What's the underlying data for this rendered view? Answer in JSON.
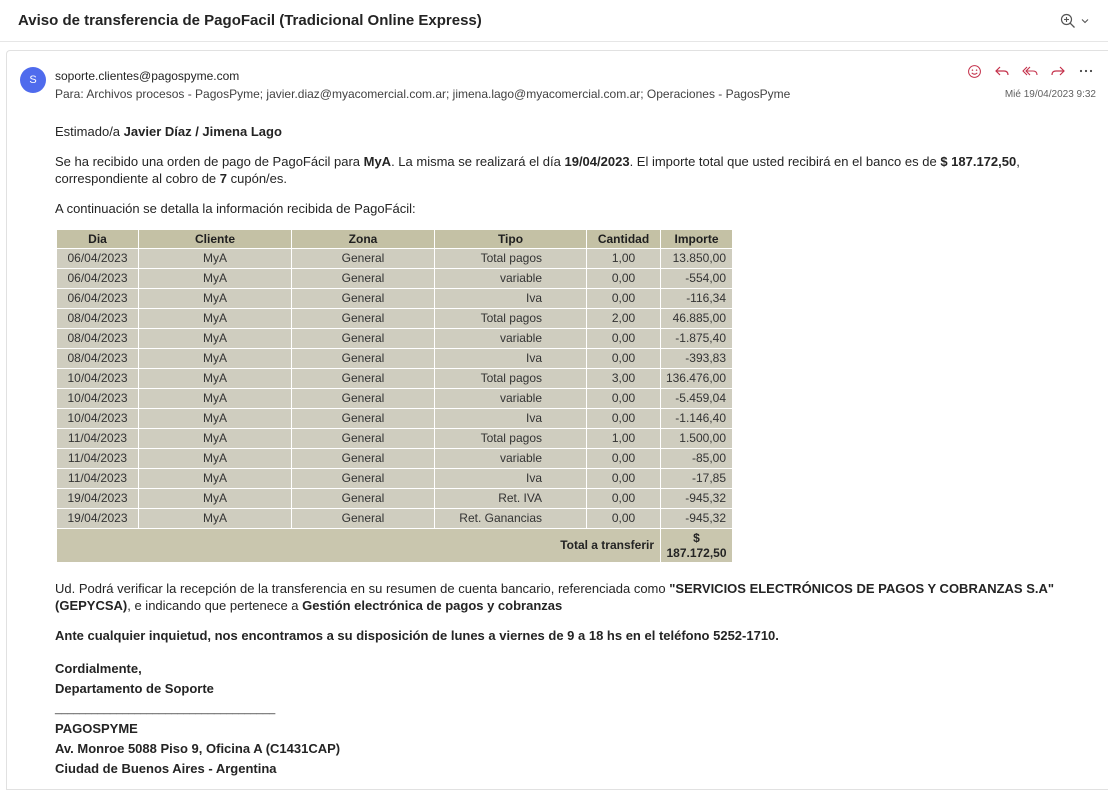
{
  "subject": "Aviso de transferencia de PagoFacil (Tradicional Online Express)",
  "sender": {
    "avatar_initial": "S",
    "from": "soporte.clientes@pagospyme.com",
    "to": "Para:  Archivos procesos - PagosPyme; javier.diaz@myacomercial.com.ar; jimena.lago@myacomercial.com.ar; Operaciones - PagosPyme",
    "date": "Mié 19/04/2023 9:32"
  },
  "actions": [
    "emoji-icon",
    "reply-icon",
    "reply-all-icon",
    "forward-icon",
    "more-icon"
  ],
  "accent": "#c4314b",
  "body": {
    "greeting_prefix": "Estimado/a ",
    "greeting_name": "Javier Díaz / Jimena Lago",
    "order_1": "Se ha recibido una orden de pago de PagoFácil para ",
    "order_company": "MyA",
    "order_2": ". La misma se realizará el día ",
    "order_date": "19/04/2023",
    "order_3": ". El importe total que usted recibirá en el banco es de ",
    "order_amount": "$ 187.172,50",
    "order_4": ", correspondiente al cobro de ",
    "order_count": "7",
    "order_5": " cupón/es.",
    "detail": "A continuación se detalla la información recibida de PagoFácil:",
    "verify_1": "Ud. Podrá verificar la recepción de la transferencia en su resumen de cuenta bancario, referenciada como ",
    "verify_ref": "\"SERVICIOS ELECTRÓNICOS DE PAGOS Y COBRANZAS S.A\" (GEPYCSA)",
    "verify_2": ", e indicando que pertenece a ",
    "verify_service": "Gestión electrónica de pagos y cobranzas",
    "help": "Ante cualquier inquietud, nos encontramos a su disposición de lunes a viernes de 9 a 18 hs en el teléfono 5252-1710.",
    "signature": [
      "Cordialmente,",
      "Departamento de Soporte",
      "____________________________________",
      "PAGOSPYME",
      "Av. Monroe 5088 Piso 9, Oficina A (C1431CAP)",
      "Ciudad de Buenos Aires - Argentina"
    ]
  },
  "table": {
    "headers": [
      "Dia",
      "Cliente",
      "Zona",
      "Tipo",
      "Cantidad",
      "Importe"
    ],
    "rows": [
      [
        "06/04/2023",
        "MyA",
        "General",
        "Total pagos",
        "1,00",
        "13.850,00"
      ],
      [
        "06/04/2023",
        "MyA",
        "General",
        "variable",
        "0,00",
        "-554,00"
      ],
      [
        "06/04/2023",
        "MyA",
        "General",
        "Iva",
        "0,00",
        "-116,34"
      ],
      [
        "08/04/2023",
        "MyA",
        "General",
        "Total pagos",
        "2,00",
        "46.885,00"
      ],
      [
        "08/04/2023",
        "MyA",
        "General",
        "variable",
        "0,00",
        "-1.875,40"
      ],
      [
        "08/04/2023",
        "MyA",
        "General",
        "Iva",
        "0,00",
        "-393,83"
      ],
      [
        "10/04/2023",
        "MyA",
        "General",
        "Total pagos",
        "3,00",
        "136.476,00"
      ],
      [
        "10/04/2023",
        "MyA",
        "General",
        "variable",
        "0,00",
        "-5.459,04"
      ],
      [
        "10/04/2023",
        "MyA",
        "General",
        "Iva",
        "0,00",
        "-1.146,40"
      ],
      [
        "11/04/2023",
        "MyA",
        "General",
        "Total pagos",
        "1,00",
        "1.500,00"
      ],
      [
        "11/04/2023",
        "MyA",
        "General",
        "variable",
        "0,00",
        "-85,00"
      ],
      [
        "11/04/2023",
        "MyA",
        "General",
        "Iva",
        "0,00",
        "-17,85"
      ],
      [
        "19/04/2023",
        "MyA",
        "General",
        "Ret. IVA",
        "0,00",
        "-945,32"
      ],
      [
        "19/04/2023",
        "MyA",
        "General",
        "Ret. Ganancias",
        "0,00",
        "-945,32"
      ]
    ],
    "total_label": "Total a transferir",
    "total_currency": "$",
    "total_value": "187.172,50"
  }
}
